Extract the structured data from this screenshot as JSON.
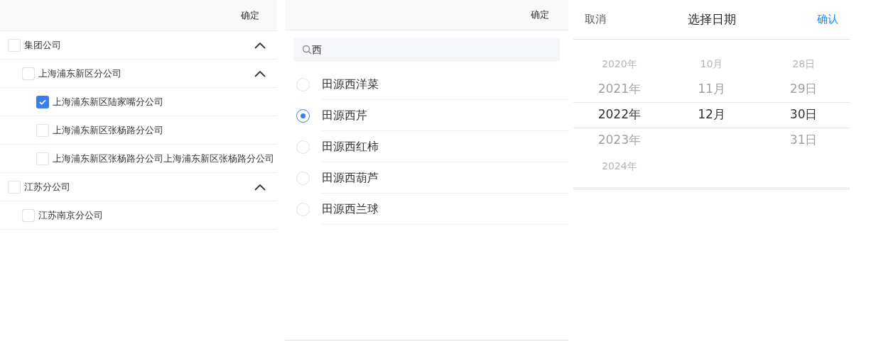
{
  "tree_panel": {
    "confirm": "确定",
    "items": [
      {
        "label": "集团公司",
        "checked": false,
        "expanded": true,
        "children": [
          {
            "label": "上海浦东新区分公司",
            "checked": false,
            "expanded": true,
            "children": [
              {
                "label": "上海浦东新区陆家嘴分公司",
                "checked": true
              },
              {
                "label": "上海浦东新区张杨路分公司",
                "checked": false
              },
              {
                "label": "上海浦东新区张杨路分公司上海浦东新区张杨路分公司",
                "checked": false
              }
            ]
          }
        ]
      },
      {
        "label": "江苏分公司",
        "checked": false,
        "expanded": true,
        "children": [
          {
            "label": "江苏南京分公司",
            "checked": false
          }
        ]
      }
    ]
  },
  "radio_panel": {
    "confirm": "确定",
    "search": {
      "value": "西"
    },
    "options": [
      {
        "label": "田源西洋菜",
        "selected": false
      },
      {
        "label": "田源西芹",
        "selected": true
      },
      {
        "label": "田源西红柿",
        "selected": false
      },
      {
        "label": "田源西葫芦",
        "selected": false
      },
      {
        "label": "田源西兰球",
        "selected": false
      }
    ]
  },
  "date_picker": {
    "cancel": "取消",
    "title": "选择日期",
    "confirm": "确认",
    "columns": [
      {
        "items": [
          {
            "label": "2020年",
            "selected": false
          },
          {
            "label": "2021年",
            "selected": false
          },
          {
            "label": "2022年",
            "selected": true
          },
          {
            "label": "2023年",
            "selected": false
          },
          {
            "label": "2024年",
            "selected": false
          }
        ]
      },
      {
        "items": [
          {
            "label": "10月",
            "selected": false
          },
          {
            "label": "11月",
            "selected": false
          },
          {
            "label": "12月",
            "selected": true
          }
        ]
      },
      {
        "items": [
          {
            "label": "28日",
            "selected": false
          },
          {
            "label": "29日",
            "selected": false
          },
          {
            "label": "30日",
            "selected": true
          },
          {
            "label": "31日",
            "selected": false
          }
        ]
      }
    ]
  }
}
